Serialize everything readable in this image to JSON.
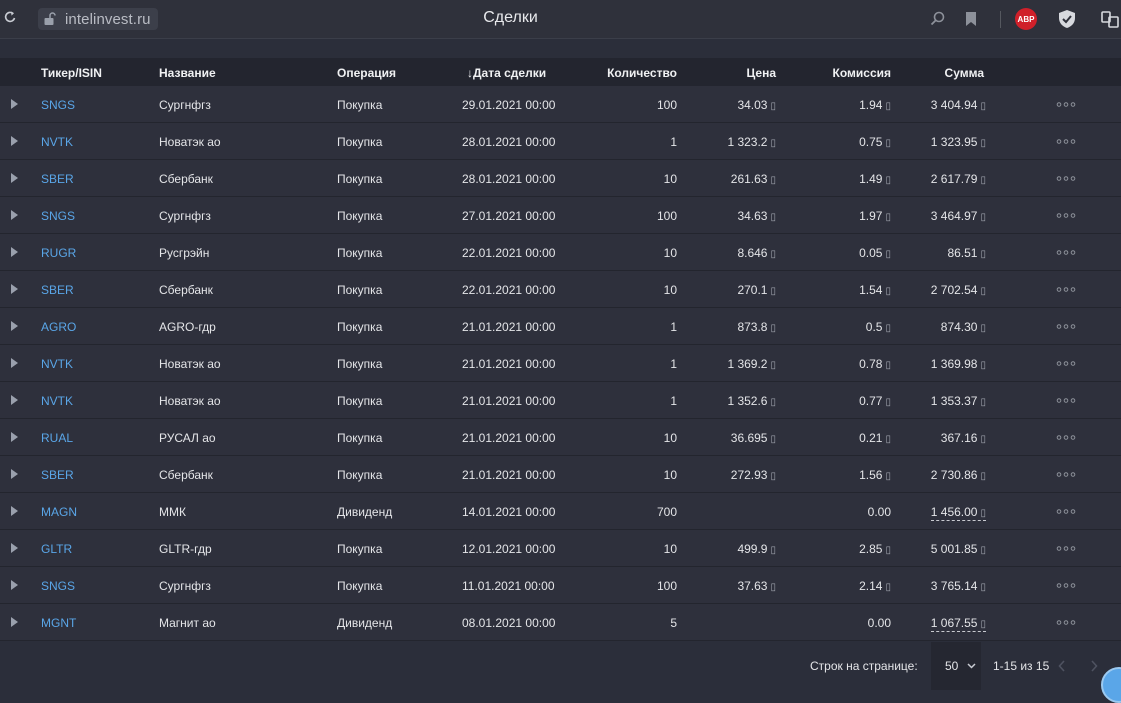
{
  "browser": {
    "url": "intelinvest.ru",
    "page_title": "Сделки",
    "abp_label": "ABP"
  },
  "table": {
    "headers": {
      "ticker": "Тикер/ISIN",
      "name": "Название",
      "operation": "Операция",
      "date": "Дата сделки",
      "quantity": "Количество",
      "price": "Цена",
      "fee": "Комиссия",
      "sum": "Сумма"
    },
    "sort_indicator": "↓",
    "currency_glyph": "▯",
    "rows": [
      {
        "ticker": "SNGS",
        "name": "Сургнфгз",
        "operation": "Покупка",
        "date": "29.01.2021 00:00",
        "quantity": "100",
        "price": "34.03",
        "fee": "1.94",
        "sum": "3 404.94",
        "dashed": false
      },
      {
        "ticker": "NVTK",
        "name": "Новатэк ао",
        "operation": "Покупка",
        "date": "28.01.2021 00:00",
        "quantity": "1",
        "price": "1 323.2",
        "fee": "0.75",
        "sum": "1 323.95",
        "dashed": false
      },
      {
        "ticker": "SBER",
        "name": "Сбербанк",
        "operation": "Покупка",
        "date": "28.01.2021 00:00",
        "quantity": "10",
        "price": "261.63",
        "fee": "1.49",
        "sum": "2 617.79",
        "dashed": false
      },
      {
        "ticker": "SNGS",
        "name": "Сургнфгз",
        "operation": "Покупка",
        "date": "27.01.2021 00:00",
        "quantity": "100",
        "price": "34.63",
        "fee": "1.97",
        "sum": "3 464.97",
        "dashed": false
      },
      {
        "ticker": "RUGR",
        "name": "Русгрэйн",
        "operation": "Покупка",
        "date": "22.01.2021 00:00",
        "quantity": "10",
        "price": "8.646",
        "fee": "0.05",
        "sum": "86.51",
        "dashed": false
      },
      {
        "ticker": "SBER",
        "name": "Сбербанк",
        "operation": "Покупка",
        "date": "22.01.2021 00:00",
        "quantity": "10",
        "price": "270.1",
        "fee": "1.54",
        "sum": "2 702.54",
        "dashed": false
      },
      {
        "ticker": "AGRO",
        "name": "AGRO-гдр",
        "operation": "Покупка",
        "date": "21.01.2021 00:00",
        "quantity": "1",
        "price": "873.8",
        "fee": "0.5",
        "sum": "874.30",
        "dashed": false
      },
      {
        "ticker": "NVTK",
        "name": "Новатэк ао",
        "operation": "Покупка",
        "date": "21.01.2021 00:00",
        "quantity": "1",
        "price": "1 369.2",
        "fee": "0.78",
        "sum": "1 369.98",
        "dashed": false
      },
      {
        "ticker": "NVTK",
        "name": "Новатэк ао",
        "operation": "Покупка",
        "date": "21.01.2021 00:00",
        "quantity": "1",
        "price": "1 352.6",
        "fee": "0.77",
        "sum": "1 353.37",
        "dashed": false
      },
      {
        "ticker": "RUAL",
        "name": "РУСАЛ ао",
        "operation": "Покупка",
        "date": "21.01.2021 00:00",
        "quantity": "10",
        "price": "36.695",
        "fee": "0.21",
        "sum": "367.16",
        "dashed": false
      },
      {
        "ticker": "SBER",
        "name": "Сбербанк",
        "operation": "Покупка",
        "date": "21.01.2021 00:00",
        "quantity": "10",
        "price": "272.93",
        "fee": "1.56",
        "sum": "2 730.86",
        "dashed": false
      },
      {
        "ticker": "MAGN",
        "name": "ММК",
        "operation": "Дивиденд",
        "date": "14.01.2021 00:00",
        "quantity": "700",
        "price": "",
        "fee": "0.00",
        "sum": "1 456.00",
        "dashed": true
      },
      {
        "ticker": "GLTR",
        "name": "GLTR-гдр",
        "operation": "Покупка",
        "date": "12.01.2021 00:00",
        "quantity": "10",
        "price": "499.9",
        "fee": "2.85",
        "sum": "5 001.85",
        "dashed": false
      },
      {
        "ticker": "SNGS",
        "name": "Сургнфгз",
        "operation": "Покупка",
        "date": "11.01.2021 00:00",
        "quantity": "100",
        "price": "37.63",
        "fee": "2.14",
        "sum": "3 765.14",
        "dashed": false
      },
      {
        "ticker": "MGNT",
        "name": "Магнит ао",
        "operation": "Дивиденд",
        "date": "08.01.2021 00:00",
        "quantity": "5",
        "price": "",
        "fee": "0.00",
        "sum": "1 067.55",
        "dashed": true
      }
    ]
  },
  "pagination": {
    "rows_per_page_label": "Строк на странице:",
    "rows_per_page_value": "50",
    "range_label": "1-15 из 15"
  },
  "icons": {
    "reload": "reload-icon",
    "lock": "unlocked-padlock-icon",
    "search": "search-icon",
    "bookmark": "bookmark-icon",
    "shield": "shield-check-icon",
    "extensions": "extensions-icon",
    "expand": "expand-row-icon",
    "more": "more-dots-icon"
  },
  "colors": {
    "ticker": "#5aa6e8",
    "background": "#2b2e3a",
    "header": "#23252f",
    "abp": "#d0202a"
  }
}
